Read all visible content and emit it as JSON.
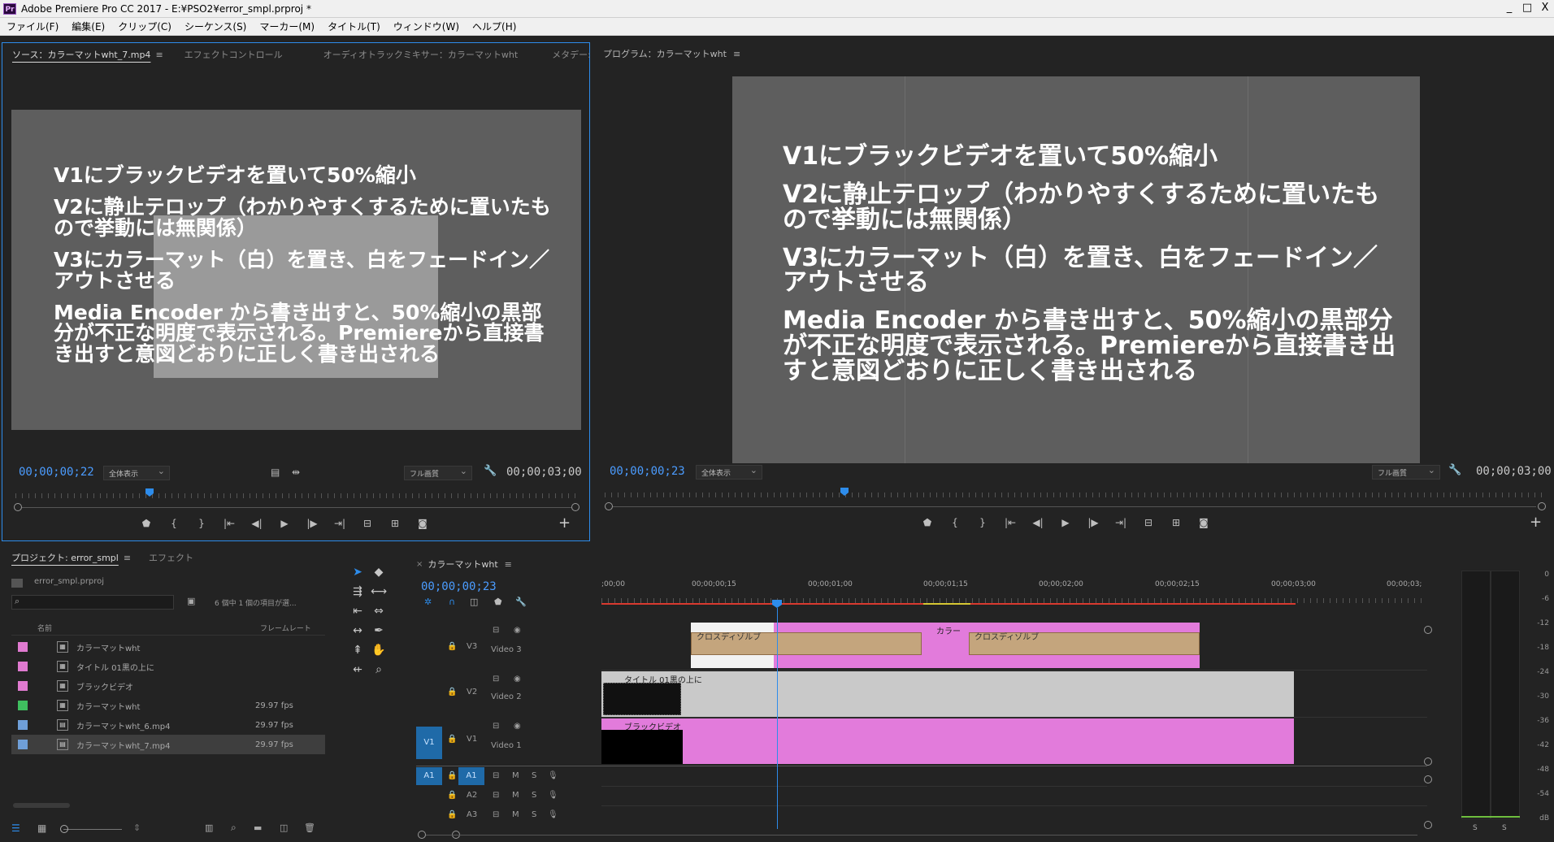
{
  "window": {
    "title": "Adobe Premiere Pro CC 2017 - E:¥PSO2¥error_smpl.prproj *",
    "app_icon": "Pr",
    "controls": [
      "_",
      "□",
      "X"
    ]
  },
  "menu": [
    "ファイル(F)",
    "編集(E)",
    "クリップ(C)",
    "シーケンス(S)",
    "マーカー(M)",
    "タイトル(T)",
    "ウィンドウ(W)",
    "ヘルプ(H)"
  ],
  "source_monitor": {
    "tabs": [
      "ソース：カラーマットwht_7.mp4",
      "エフェクトコントロール",
      "オーディオトラックミキサー：カラーマットwht",
      "メタデー:"
    ],
    "overflow": "»",
    "timecode": "00;00;00;22",
    "zoom": "全体表示",
    "quality": "フル画質",
    "duration": "00;00;03;00"
  },
  "program_monitor": {
    "tab": "プログラム：カラーマットwht",
    "timecode": "00;00;00;23",
    "zoom": "全体表示",
    "quality": "フル画質",
    "duration": "00;00;03;00"
  },
  "video_text": [
    "V1にブラックビデオを置いて50%縮小",
    "V2に静止テロップ（わかりやすくするために置いたもので挙動には無関係）",
    "V3にカラーマット（白）を置き、白をフェードイン／アウトさせる",
    "Media Encoder から書き出すと、50%縮小の黒部分が不正な明度で表示される。Premiereから直接書き出すと意図どおりに正しく書き出される"
  ],
  "transport_icons": [
    "marker",
    "in",
    "out",
    "go-in",
    "step-back",
    "play",
    "step-fwd",
    "go-out",
    "insert",
    "overwrite",
    "export-frame"
  ],
  "project": {
    "tabs": [
      "プロジェクト: error_smpl",
      "エフェクト"
    ],
    "file": "error_smpl.prproj",
    "search_placeholder": "",
    "count_text": "6 個中 1 個の項目が選...",
    "col_name": "名前",
    "col_rate": "フレームレート",
    "items": [
      {
        "name": "カラーマットwht",
        "rate": "",
        "color": "#e07ad0",
        "icon": "seq"
      },
      {
        "name": "タイトル 01黒の上に",
        "rate": "",
        "color": "#e07ad0",
        "icon": "seq"
      },
      {
        "name": "ブラックビデオ",
        "rate": "",
        "color": "#e07ad0",
        "icon": "seq"
      },
      {
        "name": "カラーマットwht",
        "rate": "29.97 fps",
        "color": "#3fbf5f",
        "icon": "seq"
      },
      {
        "name": "カラーマットwht_6.mp4",
        "rate": "29.97 fps",
        "color": "#6f9fd8",
        "icon": "clip"
      },
      {
        "name": "カラーマットwht_7.mp4",
        "rate": "29.97 fps",
        "color": "#6f9fd8",
        "icon": "clip"
      }
    ]
  },
  "timeline": {
    "tab": "カラーマットwht",
    "timecode": "00;00;00;23",
    "ruler_labels": [
      ";00;00",
      "00;00;00;15",
      "00;00;01;00",
      "00;00;01;15",
      "00;00;02;00",
      "00;00;02;15",
      "00;00;03;00",
      "00;00;03;"
    ],
    "tracks": [
      {
        "id": "V3",
        "label": "Video 3"
      },
      {
        "id": "V2",
        "label": "Video 2"
      },
      {
        "id": "V1",
        "label": "Video 1",
        "src": "V1"
      },
      {
        "id": "A1",
        "src": "A1"
      },
      {
        "id": "A2"
      },
      {
        "id": "A3"
      }
    ],
    "audio_buttons": {
      "m": "M",
      "s": "S"
    },
    "clips": {
      "v3_label": "カラー",
      "v3_trans1": "クロスディゾルブ",
      "v3_trans2": "クロスディゾルブ",
      "v2_label": "タイトル 01黒の上に",
      "v1_label": "ブラックビデオ"
    }
  },
  "meter": {
    "scale": [
      "0",
      "-6",
      "-12",
      "-18",
      "-24",
      "-30",
      "-36",
      "-42",
      "-48",
      "-54",
      "dB"
    ],
    "solo": [
      "S",
      "S"
    ]
  }
}
